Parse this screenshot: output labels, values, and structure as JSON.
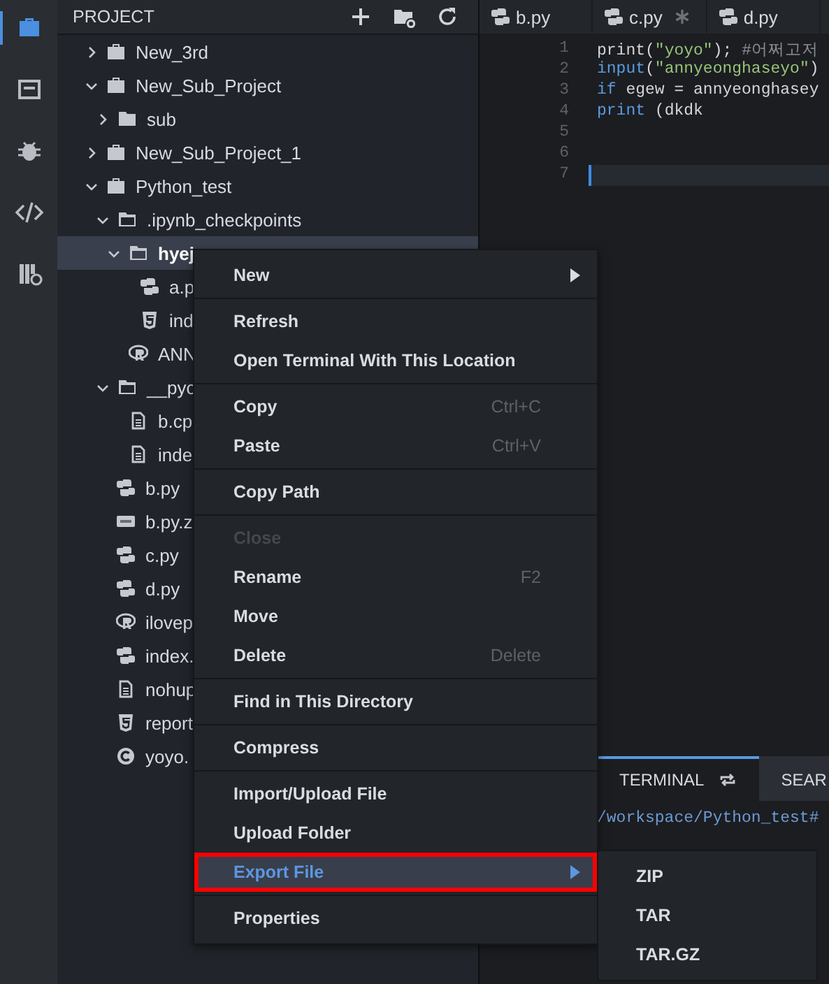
{
  "activity_bar": [
    {
      "kind": "briefcase",
      "selected": true
    },
    {
      "kind": "window",
      "selected": false
    },
    {
      "kind": "bug",
      "selected": false
    },
    {
      "kind": "code",
      "selected": false
    },
    {
      "kind": "library",
      "selected": false
    }
  ],
  "sidebar": {
    "title": "PROJECT",
    "tree": [
      {
        "label": "New_3rd",
        "kind": "project",
        "expanded": false,
        "selected": false
      },
      {
        "label": "New_Sub_Project",
        "kind": "project",
        "expanded": true,
        "selected": false,
        "children": [
          {
            "label": "sub",
            "kind": "folder",
            "expanded": false,
            "selected": false
          }
        ]
      },
      {
        "label": "New_Sub_Project_1",
        "kind": "project",
        "expanded": false,
        "selected": false
      },
      {
        "label": "Python_test",
        "kind": "project",
        "expanded": true,
        "selected": false,
        "children": [
          {
            "label": ".ipynb_checkpoints",
            "kind": "folder",
            "expanded": true,
            "selected": false,
            "children": [
              {
                "label": "hyej",
                "kind": "folder",
                "expanded": true,
                "selected": true,
                "children": [
                  {
                    "label": "a.p",
                    "kind": "python",
                    "selected": false
                  },
                  {
                    "label": "ind",
                    "kind": "html",
                    "selected": false
                  }
                ]
              },
              {
                "label": "ANN",
                "kind": "r",
                "selected": false
              }
            ]
          },
          {
            "label": "__pyc",
            "kind": "folder",
            "expanded": true,
            "selected": false,
            "children": [
              {
                "label": "b.cp",
                "kind": "file",
                "selected": false
              },
              {
                "label": "inde",
                "kind": "file",
                "selected": false
              }
            ]
          },
          {
            "label": "b.py",
            "kind": "python",
            "selected": false
          },
          {
            "label": "b.py.z",
            "kind": "zip",
            "selected": false
          },
          {
            "label": "c.py",
            "kind": "python",
            "selected": false
          },
          {
            "label": "d.py",
            "kind": "python",
            "selected": false
          },
          {
            "label": "ilovep",
            "kind": "r",
            "selected": false
          },
          {
            "label": "index.",
            "kind": "python",
            "selected": false
          },
          {
            "label": "nohup",
            "kind": "file",
            "selected": false
          },
          {
            "label": "report",
            "kind": "html",
            "selected": false
          },
          {
            "label": "yoyo.",
            "kind": "c",
            "selected": false
          }
        ]
      }
    ]
  },
  "editor": {
    "tabs": [
      {
        "label": "b.py",
        "modified": false
      },
      {
        "label": "c.py",
        "modified": true
      },
      {
        "label": "d.py",
        "modified": false
      }
    ],
    "lines": [
      {
        "number": "1",
        "current": false,
        "tokens": [
          {
            "text": "print(",
            "kind": "plain"
          },
          {
            "text": "\"yoyo\"",
            "kind": "string"
          },
          {
            "text": "); ",
            "kind": "plain"
          },
          {
            "text": "#어쩌고저",
            "kind": "comment"
          }
        ]
      },
      {
        "number": "2",
        "current": false,
        "tokens": [
          {
            "text": "input",
            "kind": "keyword"
          },
          {
            "text": "(",
            "kind": "plain"
          },
          {
            "text": "\"annyeonghaseyo\"",
            "kind": "string"
          },
          {
            "text": ")",
            "kind": "plain"
          }
        ]
      },
      {
        "number": "3",
        "current": false,
        "tokens": [
          {
            "text": " if",
            "kind": "keyword"
          },
          {
            "text": " egew = annyeonghasey",
            "kind": "plain"
          }
        ]
      },
      {
        "number": "4",
        "current": false,
        "tokens": [
          {
            "text": " print",
            "kind": "keyword"
          },
          {
            "text": " (dkdk",
            "kind": "plain"
          }
        ]
      },
      {
        "number": "5",
        "current": false
      },
      {
        "number": "6",
        "current": false
      },
      {
        "number": "7",
        "current": true
      }
    ]
  },
  "panel": {
    "tabs": [
      {
        "label": "TERMINAL",
        "selected": true
      },
      {
        "label": "SEAR",
        "selected": false
      }
    ],
    "prompt": "/workspace/Python_test#"
  },
  "context_menu": {
    "groups": [
      [
        {
          "label": "New",
          "submenu": true,
          "disabled": false,
          "selected": false,
          "outlined": false
        }
      ],
      [
        {
          "label": "Refresh",
          "disabled": false,
          "selected": false,
          "outlined": false
        },
        {
          "label": "Open Terminal With This Location",
          "disabled": false,
          "selected": false,
          "outlined": false
        }
      ],
      [
        {
          "label": "Copy",
          "shortcut": "Ctrl+C",
          "disabled": false,
          "selected": false,
          "outlined": false
        },
        {
          "label": "Paste",
          "shortcut": "Ctrl+V",
          "disabled": false,
          "selected": false,
          "outlined": false
        }
      ],
      [
        {
          "label": "Copy Path",
          "disabled": false,
          "selected": false,
          "outlined": false
        }
      ],
      [
        {
          "label": "Close",
          "disabled": true,
          "selected": false,
          "outlined": false
        },
        {
          "label": "Rename",
          "shortcut": "F2",
          "disabled": false,
          "selected": false,
          "outlined": false
        },
        {
          "label": "Move",
          "disabled": false,
          "selected": false,
          "outlined": false
        },
        {
          "label": "Delete",
          "shortcut": "Delete",
          "disabled": false,
          "selected": false,
          "outlined": false
        }
      ],
      [
        {
          "label": "Find in This Directory",
          "disabled": false,
          "selected": false,
          "outlined": false
        }
      ],
      [
        {
          "label": "Compress",
          "disabled": false,
          "selected": false,
          "outlined": false
        }
      ],
      [
        {
          "label": "Import/Upload File",
          "disabled": false,
          "selected": false,
          "outlined": false
        },
        {
          "label": "Upload Folder",
          "disabled": false,
          "selected": false,
          "outlined": false
        },
        {
          "label": "Export File",
          "submenu": true,
          "disabled": false,
          "selected": true,
          "outlined": true
        }
      ],
      [
        {
          "label": "Properties",
          "disabled": false,
          "selected": false,
          "outlined": false
        }
      ]
    ]
  },
  "submenu": {
    "items": [
      {
        "label": "ZIP"
      },
      {
        "label": "TAR"
      },
      {
        "label": "TAR.GZ"
      }
    ]
  }
}
